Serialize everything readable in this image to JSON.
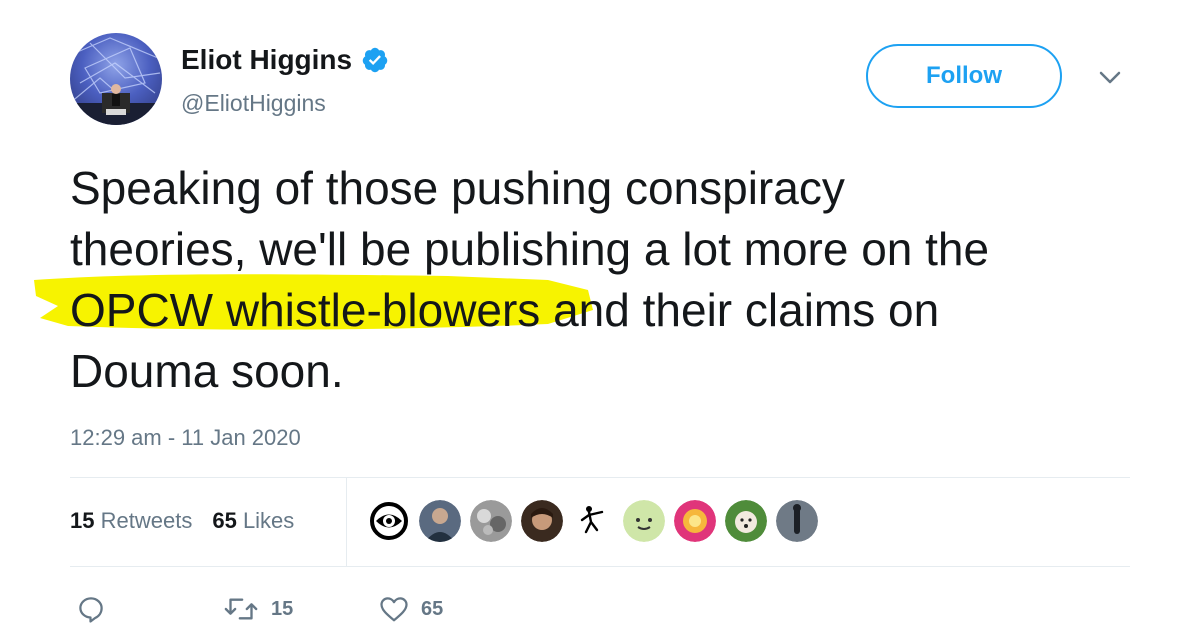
{
  "user": {
    "name": "Eliot Higgins",
    "handle": "@EliotHiggins",
    "verified": true,
    "avatar_icon": "avatar-photo"
  },
  "follow_button": {
    "label": "Follow"
  },
  "menu": {
    "icon": "chevron-down-icon"
  },
  "tweet": {
    "line_1": "Speaking of those pushing conspiracy",
    "line_2": "theories, we'll be publishing a lot more on the",
    "line_3_highlight": "OPCW whistle-blowers",
    "line_3_rest": " and their claims on",
    "line_4": "Douma soon.",
    "highlight_color": "#f7f300"
  },
  "timestamp": "12:29 am - 11 Jan 2020",
  "stats": {
    "retweets_count": "15",
    "retweets_label": "Retweets",
    "likes_count": "65",
    "likes_label": "Likes"
  },
  "likers": [
    "liker-avatar-1",
    "liker-avatar-2",
    "liker-avatar-3",
    "liker-avatar-4",
    "liker-avatar-5",
    "liker-avatar-6",
    "liker-avatar-7",
    "liker-avatar-8",
    "liker-avatar-9"
  ],
  "actions": {
    "reply_icon": "reply-icon",
    "retweet_count": "15",
    "like_count": "65"
  },
  "colors": {
    "accent": "#1da1f2",
    "text": "#14171a",
    "muted": "#657786"
  }
}
